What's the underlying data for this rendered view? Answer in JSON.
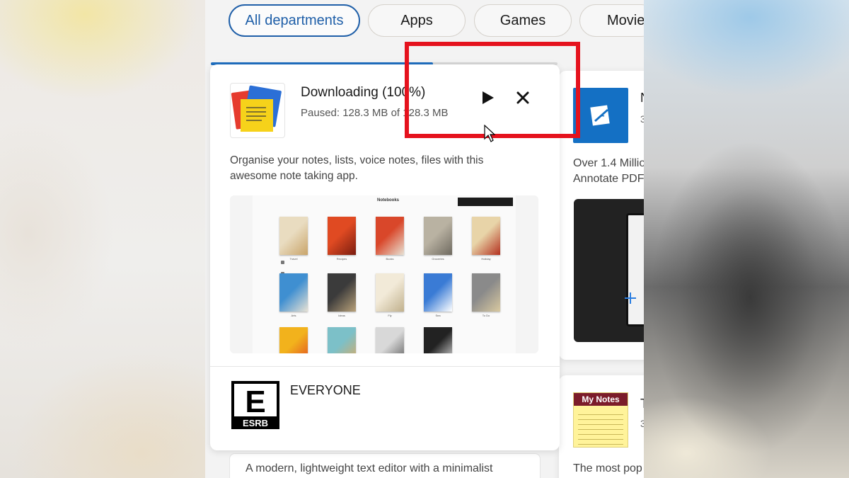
{
  "nav": {
    "pills": [
      "All departments",
      "Apps",
      "Games",
      "Movie"
    ]
  },
  "download": {
    "progress_fraction": 1.0,
    "title": "Downloading (100%)",
    "status": "Paused: 128.3 MB of 128.3 MB",
    "description": "Organise your notes, lists, voice notes, files with this awesome note taking app.",
    "screenshot": {
      "title": "Notebooks",
      "books": [
        {
          "label": "Travel"
        },
        {
          "label": "Recipes"
        },
        {
          "label": "Books"
        },
        {
          "label": "Groceries"
        },
        {
          "label": "Holiday"
        },
        {
          "label": "Arts"
        },
        {
          "label": "Ideas"
        },
        {
          "label": "Fly"
        },
        {
          "label": "Sea"
        },
        {
          "label": "To Do"
        },
        {
          "label": ""
        },
        {
          "label": ""
        },
        {
          "label": ""
        },
        {
          "label": ""
        }
      ]
    },
    "rating": {
      "letter": "E",
      "org": "ESRB",
      "text": "EVERYONE"
    }
  },
  "right_card": {
    "title_fragment": "N",
    "sub_fragment": "3",
    "desc_line1": "Over 1.4 Millio",
    "desc_line2": "Annotate PDF"
  },
  "right_card_2": {
    "icon_label": "My Notes",
    "title_fragment": "T",
    "sub_fragment": "3",
    "desc": "The most pop"
  },
  "bottom_left": {
    "desc": "A modern, lightweight text editor with a minimalist"
  },
  "colors": {
    "accent": "#1f5fa8",
    "progress": "#1f6fc0",
    "highlight": "#e5121d"
  }
}
